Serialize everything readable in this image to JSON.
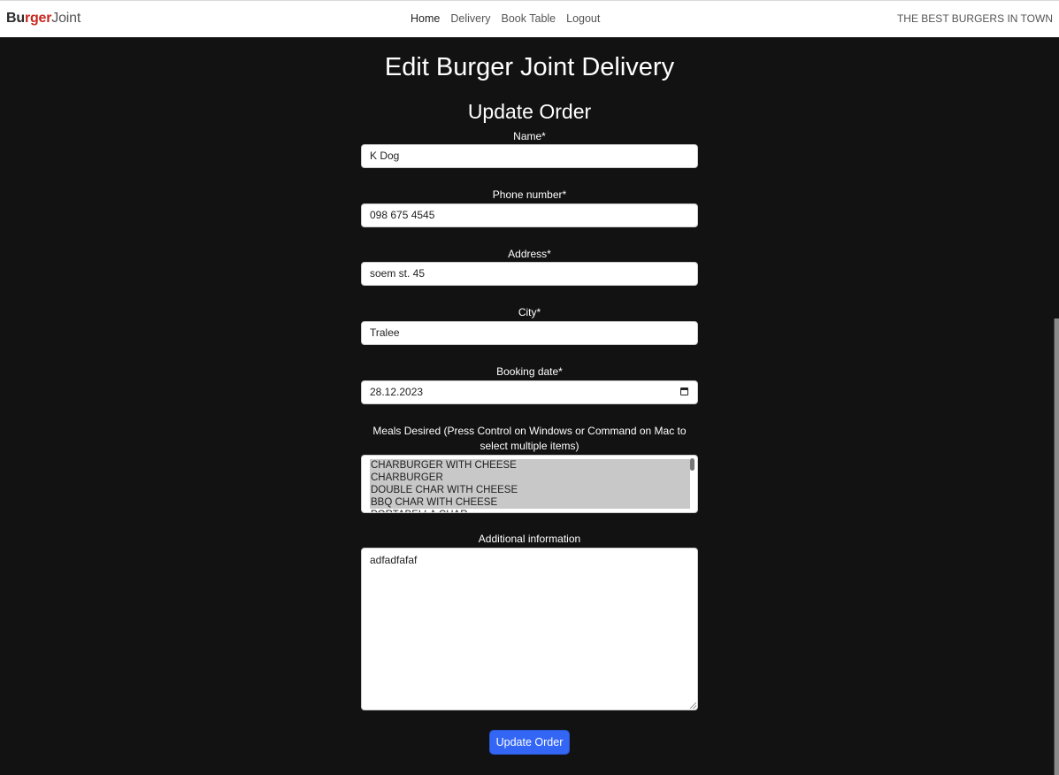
{
  "navbar": {
    "brand": {
      "part1": "Bu",
      "part2": "rger",
      "part3": "Joint"
    },
    "links": [
      {
        "label": "Home",
        "active": true
      },
      {
        "label": "Delivery",
        "active": false
      },
      {
        "label": "Book Table",
        "active": false
      },
      {
        "label": "Logout",
        "active": false
      }
    ],
    "tagline": "THE BEST BURGERS IN TOWN"
  },
  "page": {
    "title": "Edit Burger Joint Delivery",
    "subtitle": "Update Order"
  },
  "form": {
    "name": {
      "label": "Name*",
      "value": "K Dog"
    },
    "phone": {
      "label": "Phone number*",
      "value": "098 675 4545"
    },
    "address": {
      "label": "Address*",
      "value": "soem st. 45"
    },
    "city": {
      "label": "City*",
      "value": "Tralee"
    },
    "booking_date": {
      "label": "Booking date*",
      "value": "28.12.2023"
    },
    "meals": {
      "label": "Meals Desired (Press Control on Windows or Command on Mac to select multiple items)",
      "options": [
        {
          "label": "CHARBURGER WITH CHEESE",
          "selected": true
        },
        {
          "label": "CHARBURGER",
          "selected": true
        },
        {
          "label": "DOUBLE CHAR WITH CHEESE",
          "selected": true
        },
        {
          "label": "BBQ CHAR WITH CHEESE",
          "selected": true
        },
        {
          "label": "PORTABELLA CHAR",
          "selected": false
        }
      ]
    },
    "additional_info": {
      "label": "Additional information",
      "value": "adfadfafaf"
    },
    "submit_label": "Update Order"
  },
  "colors": {
    "background": "#121212",
    "brand_accent": "#c8281e",
    "primary_button": "#3366f5"
  }
}
